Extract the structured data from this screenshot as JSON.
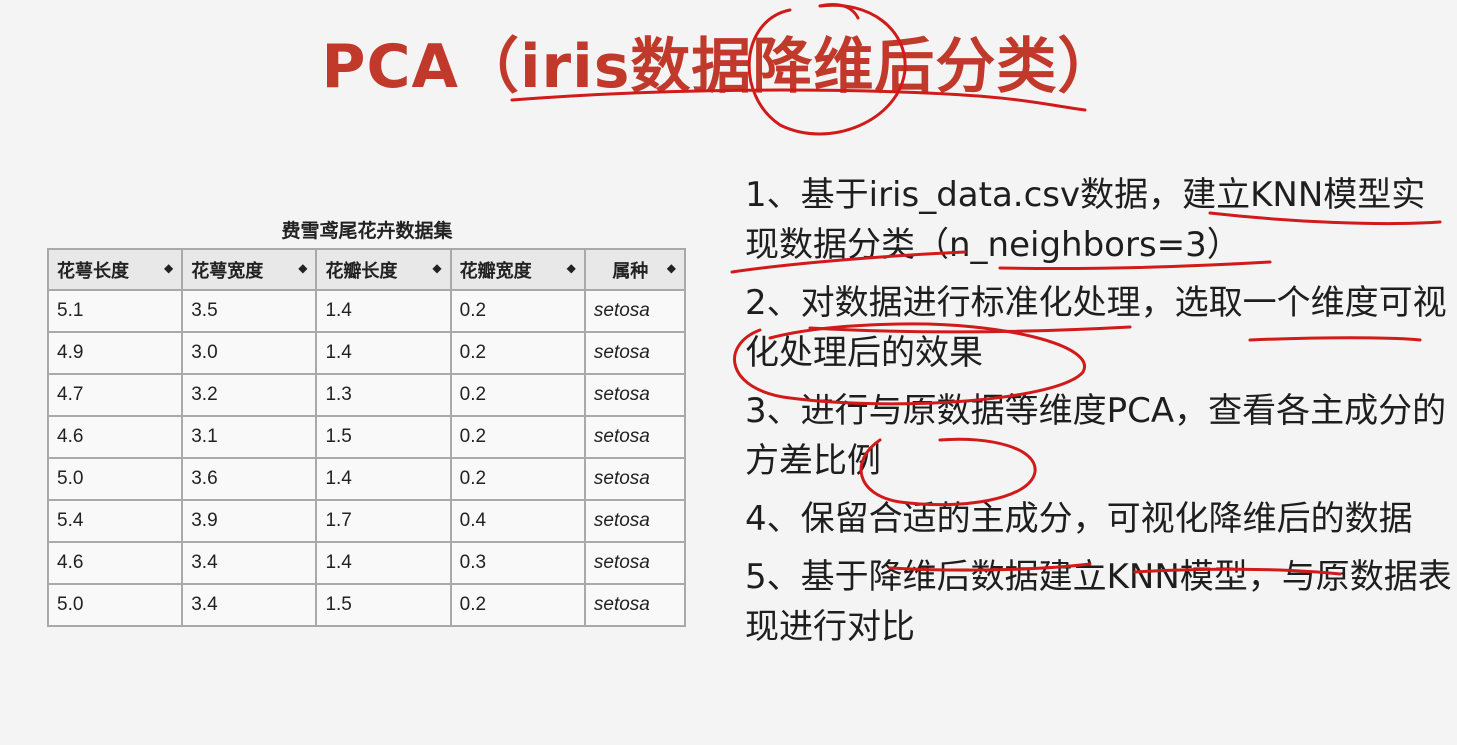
{
  "slide": {
    "title": "PCA（iris数据降维后分类）"
  },
  "table": {
    "caption": "费雪鸢尾花卉数据集",
    "headers": [
      "花萼长度",
      "花萼宽度",
      "花瓣长度",
      "花瓣宽度",
      "属种"
    ],
    "sort_glyph": "◆",
    "rows": [
      [
        "5.1",
        "3.5",
        "1.4",
        "0.2",
        "setosa"
      ],
      [
        "4.9",
        "3.0",
        "1.4",
        "0.2",
        "setosa"
      ],
      [
        "4.7",
        "3.2",
        "1.3",
        "0.2",
        "setosa"
      ],
      [
        "4.6",
        "3.1",
        "1.5",
        "0.2",
        "setosa"
      ],
      [
        "5.0",
        "3.6",
        "1.4",
        "0.2",
        "setosa"
      ],
      [
        "5.4",
        "3.9",
        "1.7",
        "0.4",
        "setosa"
      ],
      [
        "4.6",
        "3.4",
        "1.4",
        "0.3",
        "setosa"
      ],
      [
        "5.0",
        "3.4",
        "1.5",
        "0.2",
        "setosa"
      ]
    ]
  },
  "items": [
    "1、基于iris_data.csv数据，建立KNN模型实现数据分类（n_neighbors=3）",
    "2、对数据进行标准化处理，选取一个维度可视化处理后的效果",
    "3、进行与原数据等维度PCA，查看各主成分的方差比例",
    "4、保留合适的主成分，可视化降维后的数据",
    "5、基于降维后数据建立KNN模型，与原数据表现进行对比"
  ],
  "colors": {
    "title": "#c0392b",
    "annotation_ink": "#d11a1a"
  }
}
